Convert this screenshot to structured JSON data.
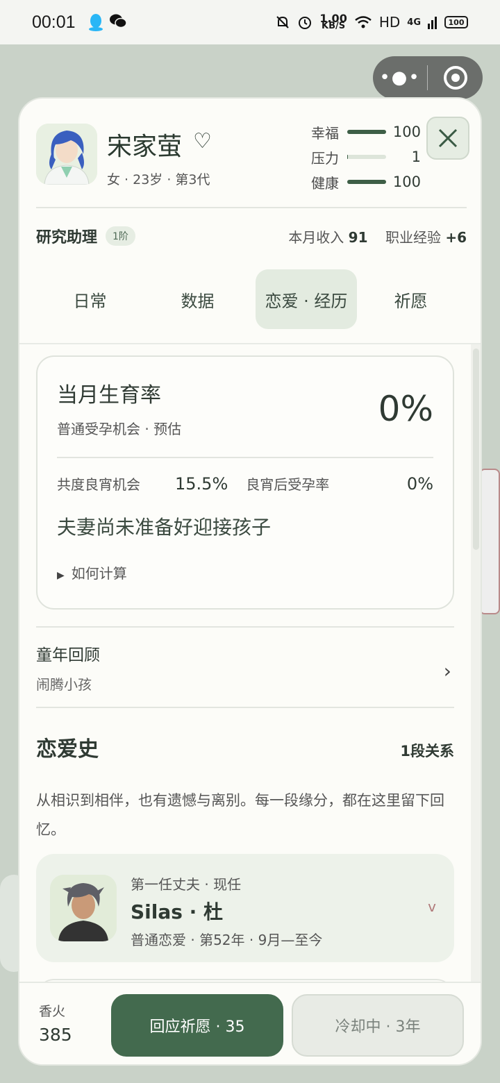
{
  "status_bar": {
    "time": "00:01",
    "net_speed": "1.00",
    "net_unit": "KB/S",
    "hd": "HD",
    "signal": "4G",
    "battery": "100"
  },
  "profile": {
    "name": "宋家萤",
    "subinfo": "女 · 23岁 · 第3代",
    "stats": [
      {
        "label": "幸福",
        "value": "100",
        "level": 1.0
      },
      {
        "label": "压力",
        "value": "1",
        "level": 0.01
      },
      {
        "label": "健康",
        "value": "100",
        "level": 1.0
      }
    ]
  },
  "job": {
    "title": "研究助理",
    "rank": "1阶",
    "income_label": "本月收入",
    "income": "91",
    "exp_label": "职业经验",
    "exp": "+6"
  },
  "tabs": [
    {
      "label": "日常"
    },
    {
      "label": "数据"
    },
    {
      "label": "恋爱 · 经历"
    },
    {
      "label": "祈愿"
    }
  ],
  "fertility": {
    "title": "当月生育率",
    "subtitle": "普通受孕机会 · 预估",
    "value": "0%",
    "chance_label": "共度良宵机会",
    "chance_value": "15.5%",
    "after_label": "良宵后受孕率",
    "after_value": "0%",
    "note": "夫妻尚未准备好迎接孩子",
    "how": "如何计算"
  },
  "childhood": {
    "title": "童年回顾",
    "subtitle": "闹腾小孩"
  },
  "love": {
    "title": "恋爱史",
    "count": "1段关系",
    "desc": "从相识到相伴，也有遗憾与离别。每一段缘分，都在这里留下回忆。",
    "partner": {
      "role": "第一任丈夫 · 现任",
      "name": "Silas · 杜",
      "info": "普通恋爱 · 第52年 · 9月—至今",
      "toggle": "v"
    }
  },
  "footer": {
    "incense_label": "香火",
    "incense_value": "385",
    "respond_label": "回应祈愿 · 35",
    "cooldown_label": "冷却中 · 3年"
  },
  "colors": {
    "accent": "#436a4e",
    "card_bg": "#fcfcf8",
    "tab_active": "#e3ebe0"
  }
}
